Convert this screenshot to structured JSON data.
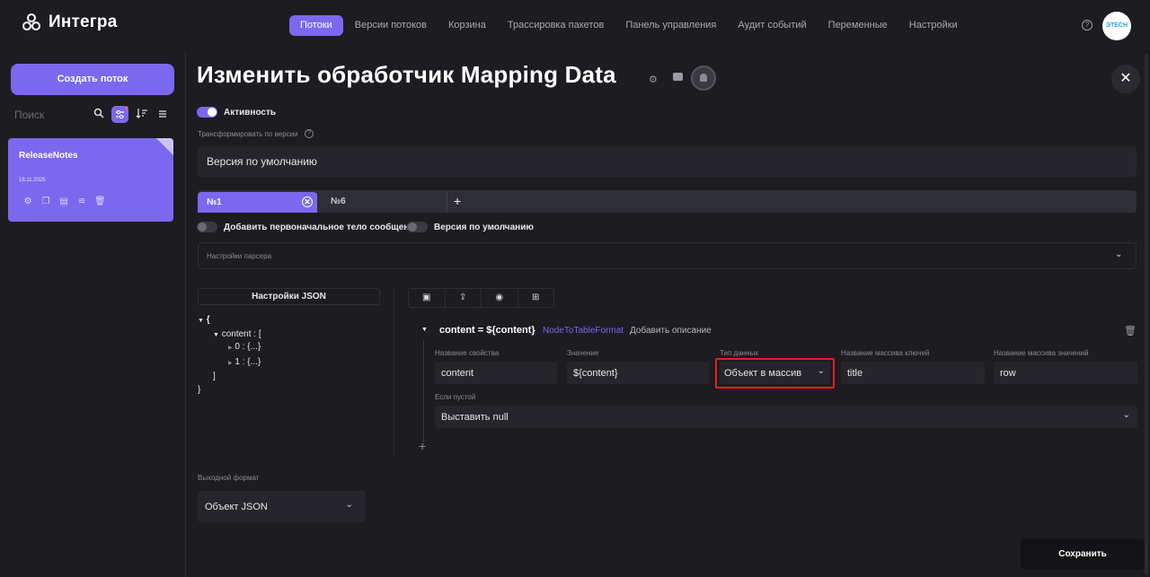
{
  "header": {
    "brand": "Интегра",
    "nav": [
      "Потоки",
      "Версии потоков",
      "Корзина",
      "Трассировка пакетов",
      "Панель управления",
      "Аудит событий",
      "Переменные",
      "Настройки"
    ],
    "active_nav": "Потоки",
    "help_icon": "?",
    "avatar_text": "ЭTECH"
  },
  "sidebar": {
    "create_button": "Создать поток",
    "search_placeholder": "Поиск",
    "flow": {
      "name": "ReleaseNotes",
      "date": "18.11.2025"
    }
  },
  "main": {
    "title": "Изменить обработчик Mapping Data",
    "active_toggle_label": "Активность",
    "transform_by_version_label": "Трансформировать по версии",
    "version_value": "Версия по умолчанию",
    "tabs": [
      {
        "label": "№1"
      },
      {
        "label": "№6"
      }
    ],
    "tab_add": "+",
    "add_original_body_label": "Добавить первоначальное тело сообщения",
    "default_version_label": "Версия по умолчанию",
    "parser_settings_label": "Настройки парсера",
    "json_settings_label": "Настройки JSON",
    "tree": {
      "open_brace": "{",
      "content_key": "content : [",
      "item0": "0 : {...}",
      "item1": "1 : {...}",
      "close_bracket": "]",
      "close_brace": "}"
    },
    "node": {
      "title": "content = ${content}",
      "format_link": "NodeToTableFormat",
      "add_description": "Добавить описание",
      "property_name_label": "Название свойства",
      "property_name": "content",
      "value_label": "Значение",
      "value": "${content}",
      "data_type_label": "Тип данных",
      "data_type": "Объект в массив",
      "keys_array_label": "Название массива ключей",
      "keys_array": "title",
      "values_array_label": "Название массива значений",
      "values_array": "row",
      "if_empty_label": "Если пустой",
      "if_empty": "Выставить null",
      "add": "+"
    },
    "output_format_label": "Выходной формат",
    "output_format": "Объект JSON",
    "save_button": "Сохранить"
  },
  "colors": {
    "accent": "#7b68ee",
    "background": "#1c1c21",
    "panel": "#25252b",
    "highlight": "#e02020"
  }
}
